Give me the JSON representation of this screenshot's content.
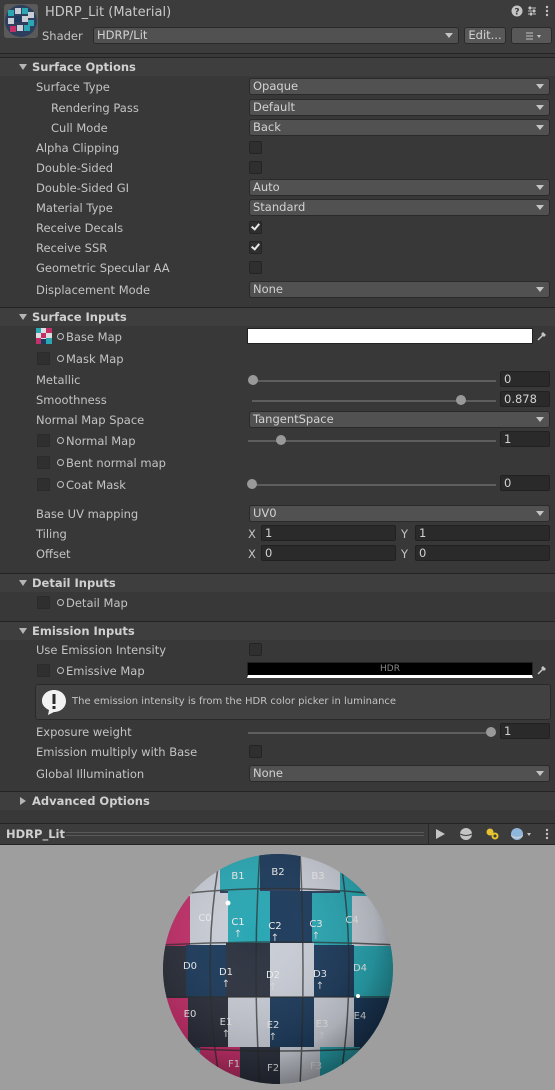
{
  "header": {
    "title": "HDRP_Lit (Material)",
    "shader_label": "Shader",
    "shader_value": "HDRP/Lit",
    "edit_button": "Edit...",
    "icons": [
      "help-icon",
      "settings-sliders-icon",
      "more-icon"
    ]
  },
  "sections": {
    "surface_options": "Surface Options",
    "surface_inputs": "Surface Inputs",
    "detail_inputs": "Detail Inputs",
    "emission_inputs": "Emission Inputs",
    "advanced_options": "Advanced Options"
  },
  "surface_options": {
    "surface_type": {
      "label": "Surface Type",
      "value": "Opaque"
    },
    "rendering_pass": {
      "label": "Rendering Pass",
      "value": "Default"
    },
    "cull_mode": {
      "label": "Cull Mode",
      "value": "Back"
    },
    "alpha_clipping": {
      "label": "Alpha Clipping",
      "checked": false
    },
    "double_sided": {
      "label": "Double-Sided",
      "checked": false
    },
    "double_sided_gi": {
      "label": "Double-Sided GI",
      "value": "Auto"
    },
    "material_type": {
      "label": "Material Type",
      "value": "Standard"
    },
    "receive_decals": {
      "label": "Receive Decals",
      "checked": true
    },
    "receive_ssr": {
      "label": "Receive SSR",
      "checked": true
    },
    "geometric_specular_aa": {
      "label": "Geometric Specular AA",
      "checked": false
    },
    "displacement_mode": {
      "label": "Displacement Mode",
      "value": "None"
    }
  },
  "surface_inputs": {
    "base_map": {
      "label": "Base Map",
      "color": "#ffffff"
    },
    "mask_map": {
      "label": "Mask Map"
    },
    "metallic": {
      "label": "Metallic",
      "value": "0",
      "fraction": 0.0
    },
    "smoothness": {
      "label": "Smoothness",
      "value": "0.878",
      "fraction": 0.878
    },
    "normal_map_space": {
      "label": "Normal Map Space",
      "value": "TangentSpace"
    },
    "normal_map": {
      "label": "Normal Map",
      "value": "1",
      "fraction": 0.125
    },
    "bent_normal_map": {
      "label": "Bent normal map"
    },
    "coat_mask": {
      "label": "Coat Mask",
      "value": "0",
      "fraction": 0.0
    },
    "base_uv_mapping": {
      "label": "Base UV mapping",
      "value": "UV0"
    },
    "tiling": {
      "label": "Tiling",
      "x_label": "X",
      "x": "1",
      "y_label": "Y",
      "y": "1"
    },
    "offset": {
      "label": "Offset",
      "x_label": "X",
      "x": "0",
      "y_label": "Y",
      "y": "0"
    }
  },
  "detail_inputs": {
    "detail_map": {
      "label": "Detail Map"
    }
  },
  "emission_inputs": {
    "use_emission_intensity": {
      "label": "Use Emission Intensity",
      "checked": false
    },
    "emissive_map": {
      "label": "Emissive Map",
      "color": "#000000",
      "hdr": "HDR"
    },
    "help_text": "The emission intensity is from the HDR color picker in luminance",
    "exposure_weight": {
      "label": "Exposure weight",
      "value": "1",
      "fraction": 1.0
    },
    "emission_multiply": {
      "label": "Emission multiply with Base",
      "checked": false
    },
    "global_illumination": {
      "label": "Global Illumination",
      "value": "None"
    }
  },
  "preview": {
    "title": "HDRP_Lit",
    "icons": [
      "play-icon",
      "sphere-mesh-icon",
      "lights-icon",
      "sky-sphere-icon",
      "more-icon"
    ],
    "sphere_labels": [
      "C0",
      "C1",
      "C2",
      "C3",
      "C4",
      "D0",
      "D1",
      "D2",
      "D3",
      "D4",
      "E0",
      "E1",
      "E2",
      "E3",
      "E4",
      "F1",
      "F2",
      "F3",
      "B1",
      "B2",
      "B3"
    ]
  },
  "colors": {
    "accent_cyan": "#2aa7b3",
    "accent_magenta": "#c2306a",
    "dark_navy": "#1d3b5c",
    "light_gray": "#c9cdd6"
  }
}
